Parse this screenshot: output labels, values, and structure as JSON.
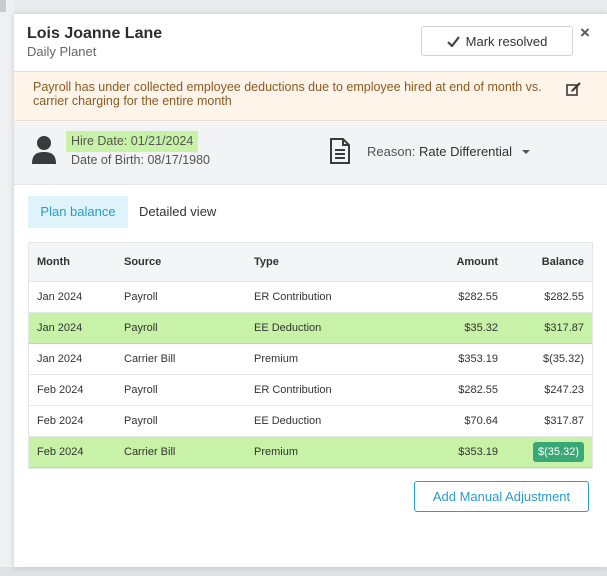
{
  "header": {
    "name": "Lois Joanne Lane",
    "company": "Daily Planet",
    "resolve_label": "Mark resolved",
    "close_glyph": "×"
  },
  "alert": {
    "message": "Payroll has under collected employee deductions due to employee hired at end of month vs. carrier charging for the entire month",
    "icon": "edit-icon"
  },
  "employee": {
    "hire_date_label": "Hire Date:",
    "hire_date": "01/21/2024",
    "dob_label": "Date of Birth:",
    "dob": "08/17/1980",
    "reason_label": "Reason:",
    "reason_value": "Rate Differential"
  },
  "tabs": [
    {
      "label": "Plan balance",
      "active": true
    },
    {
      "label": "Detailed view",
      "active": false
    }
  ],
  "table": {
    "columns": [
      "Month",
      "Source",
      "Type",
      "Amount",
      "Balance"
    ],
    "rows": [
      {
        "month": "Jan 2024",
        "source": "Payroll",
        "type": "ER Contribution",
        "amount": "$282.55",
        "balance": "$282.55",
        "highlight": false
      },
      {
        "month": "Jan 2024",
        "source": "Payroll",
        "type": "EE Deduction",
        "amount": "$35.32",
        "balance": "$317.87",
        "highlight": true
      },
      {
        "month": "Jan 2024",
        "source": "Carrier Bill",
        "type": "Premium",
        "amount": "$353.19",
        "balance": "$(35.32)",
        "highlight": false
      },
      {
        "month": "Feb 2024",
        "source": "Payroll",
        "type": "ER Contribution",
        "amount": "$282.55",
        "balance": "$247.23",
        "highlight": false
      },
      {
        "month": "Feb 2024",
        "source": "Payroll",
        "type": "EE Deduction",
        "amount": "$70.64",
        "balance": "$317.87",
        "highlight": false
      },
      {
        "month": "Feb 2024",
        "source": "Carrier Bill",
        "type": "Premium",
        "amount": "$353.19",
        "balance": "$(35.32)",
        "highlight": true
      }
    ]
  },
  "actions": {
    "add_adjustment_label": "Add Manual Adjustment"
  },
  "colors": {
    "accent": "#2a9cc8",
    "highlight": "#c8f2a8",
    "alert_bg": "#fff4ea",
    "alert_text": "#8a5a1f",
    "badge": "#3aa876"
  }
}
